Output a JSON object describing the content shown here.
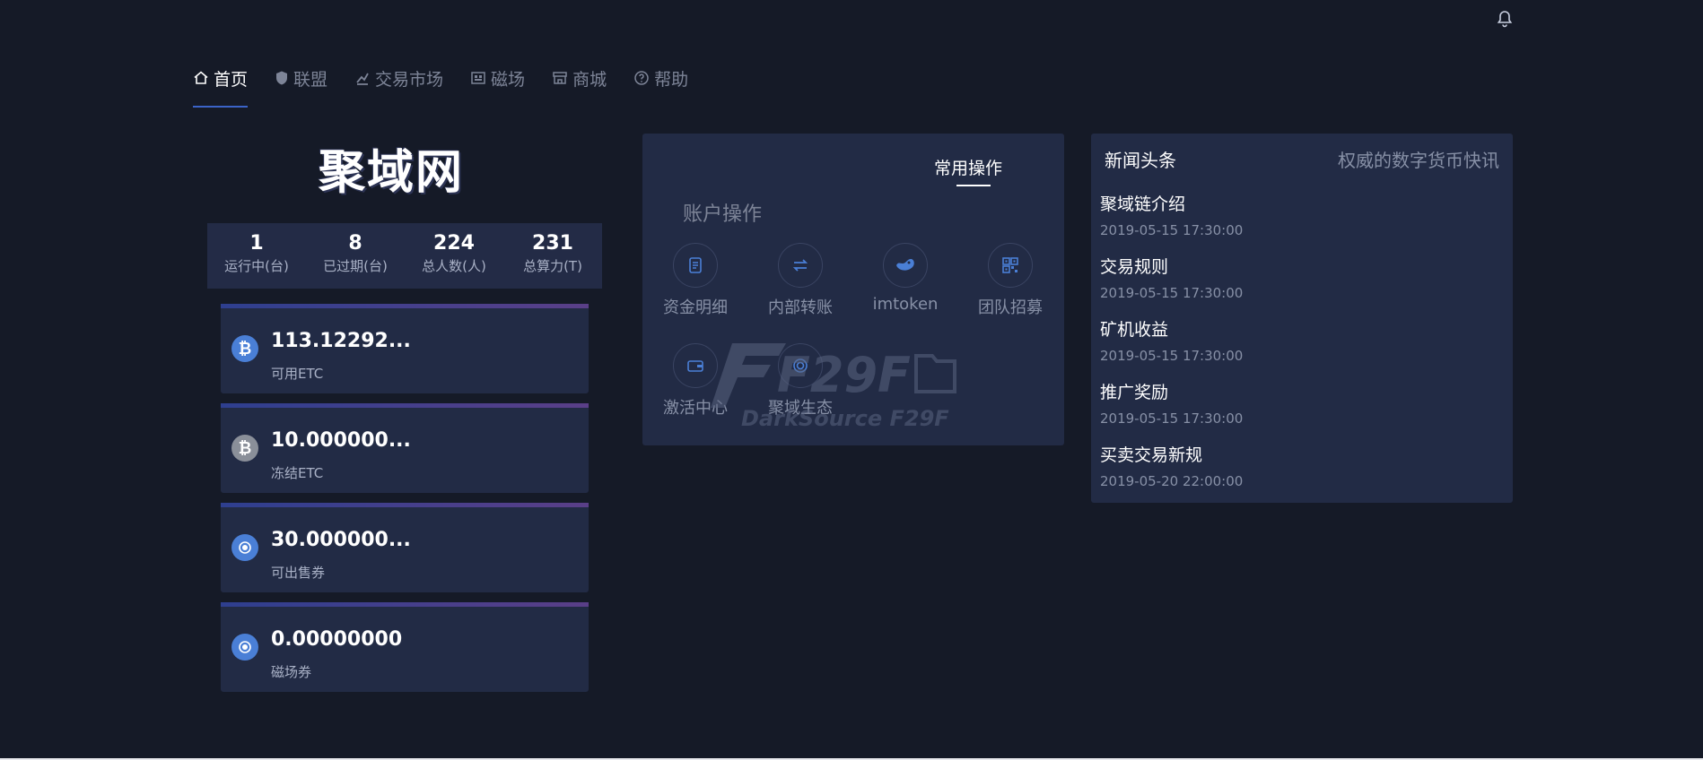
{
  "nav": {
    "items": [
      {
        "label": "首页",
        "icon": "home-icon",
        "active": true
      },
      {
        "label": "联盟",
        "icon": "shield-icon"
      },
      {
        "label": "交易市场",
        "icon": "exchange-icon"
      },
      {
        "label": "磁场",
        "icon": "field-icon"
      },
      {
        "label": "商城",
        "icon": "shop-icon"
      },
      {
        "label": "帮助",
        "icon": "help-icon"
      }
    ]
  },
  "logo": "聚域网",
  "stats": [
    {
      "value": "1",
      "label": "运行中(台)"
    },
    {
      "value": "8",
      "label": "已过期(台)"
    },
    {
      "value": "224",
      "label": "总人数(人)"
    },
    {
      "value": "231",
      "label": "总算力(T)"
    }
  ],
  "wallets": [
    {
      "value": "113.12292...",
      "label": "可用ETC",
      "icon": "bitcoin-icon",
      "color": "#4a7fd6"
    },
    {
      "value": "10.000000...",
      "label": "冻结ETC",
      "icon": "bitcoin-icon",
      "color": "#8a8f99"
    },
    {
      "value": "30.000000...",
      "label": "可出售券",
      "icon": "coupon-icon",
      "color": "#4a7fd6"
    },
    {
      "value": "0.00000000",
      "label": "磁场券",
      "icon": "coupon-icon",
      "color": "#4a7fd6"
    }
  ],
  "ops": {
    "tab": "常用操作",
    "title": "账户操作",
    "items": [
      {
        "label": "资金明细",
        "icon": "document-icon"
      },
      {
        "label": "内部转账",
        "icon": "transfer-icon"
      },
      {
        "label": "imtoken",
        "icon": "imtoken-icon"
      },
      {
        "label": "团队招募",
        "icon": "qrcode-icon"
      },
      {
        "label": "激活中心",
        "icon": "wallet-icon"
      },
      {
        "label": "聚域生态",
        "icon": "ecosystem-icon"
      }
    ]
  },
  "watermark": {
    "text1": "F29F",
    "text2": "DarkSource F29F"
  },
  "news": {
    "title": "新闻头条",
    "subtitle": "权威的数字货币快讯",
    "items": [
      {
        "title": "聚域链介绍",
        "date": "2019-05-15 17:30:00"
      },
      {
        "title": "交易规则",
        "date": "2019-05-15 17:30:00"
      },
      {
        "title": "矿机收益",
        "date": "2019-05-15 17:30:00"
      },
      {
        "title": "推广奖励",
        "date": "2019-05-15 17:30:00"
      },
      {
        "title": "买卖交易新规",
        "date": "2019-05-20 22:00:00"
      }
    ]
  }
}
